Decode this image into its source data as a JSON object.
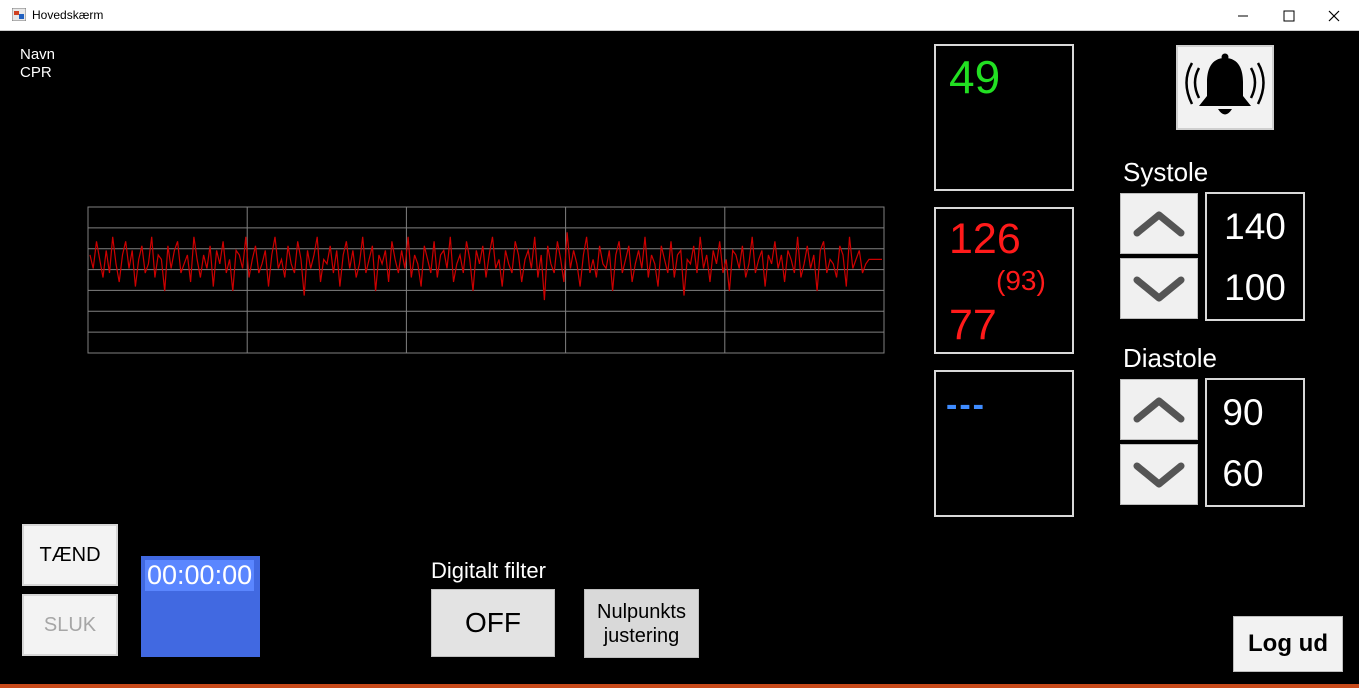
{
  "window": {
    "title": "Hovedskærm"
  },
  "patient": {
    "name_label": "Navn",
    "cpr_label": "CPR"
  },
  "chart_data": {
    "type": "line",
    "title": "",
    "xlabel": "",
    "ylabel": "",
    "grid": true,
    "line_color": "#cc0000",
    "grid_color": "#808080",
    "x_gridlines": 5,
    "y_gridlines": 7,
    "series": [
      {
        "values": [
          0.2,
          -0.1,
          0.5,
          0.1,
          -0.3,
          0.3,
          -0.2,
          0.6,
          0.0,
          -0.4,
          0.2,
          0.5,
          -0.1,
          0.3,
          -0.5,
          0.1,
          0.4,
          -0.2,
          0.0,
          0.6,
          -0.3,
          0.2,
          0.1,
          -0.6,
          0.4,
          -0.1,
          0.3,
          0.5,
          -0.2,
          0.0,
          0.2,
          -0.4,
          0.6,
          0.1,
          -0.3,
          0.2,
          -0.1,
          0.4,
          -0.5,
          0.3,
          0.0,
          0.5,
          -0.2,
          0.1,
          -0.6,
          0.3,
          0.2,
          -0.1,
          0.6,
          -0.3,
          0.1,
          0.4,
          -0.2,
          0.0,
          0.3,
          -0.5,
          0.2,
          0.6,
          -0.1,
          0.1,
          -0.3,
          0.4,
          0.0,
          -0.2,
          0.5,
          0.1,
          -0.7,
          0.3,
          -0.1,
          0.2,
          0.6,
          -0.4,
          0.1,
          0.0,
          0.4,
          -0.2,
          0.3,
          -0.5,
          0.2,
          0.5,
          -0.1,
          0.3,
          -0.3,
          0.0,
          0.6,
          -0.2,
          0.1,
          0.4,
          -0.6,
          0.2,
          0.0,
          0.3,
          -0.4,
          0.5,
          0.1,
          -0.2,
          0.3,
          -0.1,
          0.6,
          -0.3,
          0.2,
          0.0,
          -0.5,
          0.4,
          0.1,
          -0.2,
          0.5,
          -0.3,
          0.2,
          0.3,
          -0.1,
          0.6,
          -0.4,
          0.0,
          0.2,
          -0.2,
          0.5,
          0.1,
          -0.6,
          0.3,
          0.0,
          0.4,
          -0.3,
          0.2,
          0.6,
          -0.1,
          0.1,
          -0.5,
          0.3,
          0.0,
          -0.2,
          0.5,
          0.2,
          -0.4,
          0.1,
          0.3,
          -0.1,
          0.6,
          -0.3,
          0.2,
          -0.8,
          0.4,
          0.0,
          -0.2,
          0.5,
          0.1,
          -0.4,
          0.7,
          -0.1,
          0.3,
          0.0,
          -0.5,
          0.2,
          0.6,
          -0.2,
          0.1,
          -0.3,
          0.4,
          0.0,
          -0.1,
          0.3,
          -0.6,
          0.2,
          0.5,
          -0.2,
          0.1,
          0.4,
          -0.4,
          0.0,
          0.3,
          -0.1,
          0.6,
          -0.3,
          0.2,
          0.0,
          -0.5,
          0.4,
          0.1,
          -0.2,
          0.5,
          -0.3,
          0.2,
          0.3,
          -0.7,
          0.1,
          0.0,
          0.4,
          -0.2,
          0.6,
          -0.1,
          0.2,
          -0.4,
          0.3,
          0.0,
          0.5,
          -0.2,
          0.1,
          -0.6,
          0.3,
          0.2,
          -0.1,
          0.4,
          -0.3,
          0.0,
          0.6,
          -0.2,
          0.1,
          0.3,
          -0.5,
          0.2,
          0.0,
          0.5,
          -0.1,
          0.2,
          -0.4,
          0.3,
          0.1,
          -0.2,
          0.6,
          -0.3,
          0.0,
          0.4,
          -0.1,
          0.2,
          -0.6,
          0.3,
          0.5,
          -0.2,
          0.1,
          0.0,
          -0.3,
          0.4,
          0.2,
          -0.5,
          0.6,
          -0.1,
          0.1,
          0.3,
          -0.2,
          0.0,
          0.1,
          0.1,
          0.1,
          0.1,
          0.1
        ]
      }
    ]
  },
  "pulse": {
    "value": "49",
    "color": "#22e022"
  },
  "blood_pressure": {
    "systolic": "126",
    "mean": "(93)",
    "diastolic": "77",
    "color": "#ff1a1a"
  },
  "third_display": {
    "value": "---",
    "color": "#3f8cff"
  },
  "alarm": {
    "icon": "bell-ringing-icon"
  },
  "systole": {
    "label": "Systole",
    "upper": "140",
    "lower": "100"
  },
  "diastole": {
    "label": "Diastole",
    "upper": "90",
    "lower": "60"
  },
  "controls": {
    "taend_label": "TÆND",
    "sluk_label": "SLUK",
    "timer": "00:00:00",
    "filter_label": "Digitalt filter",
    "filter_button": "OFF",
    "zero_line1": "Nulpunkts",
    "zero_line2": "justering",
    "logout_label": "Log ud"
  }
}
